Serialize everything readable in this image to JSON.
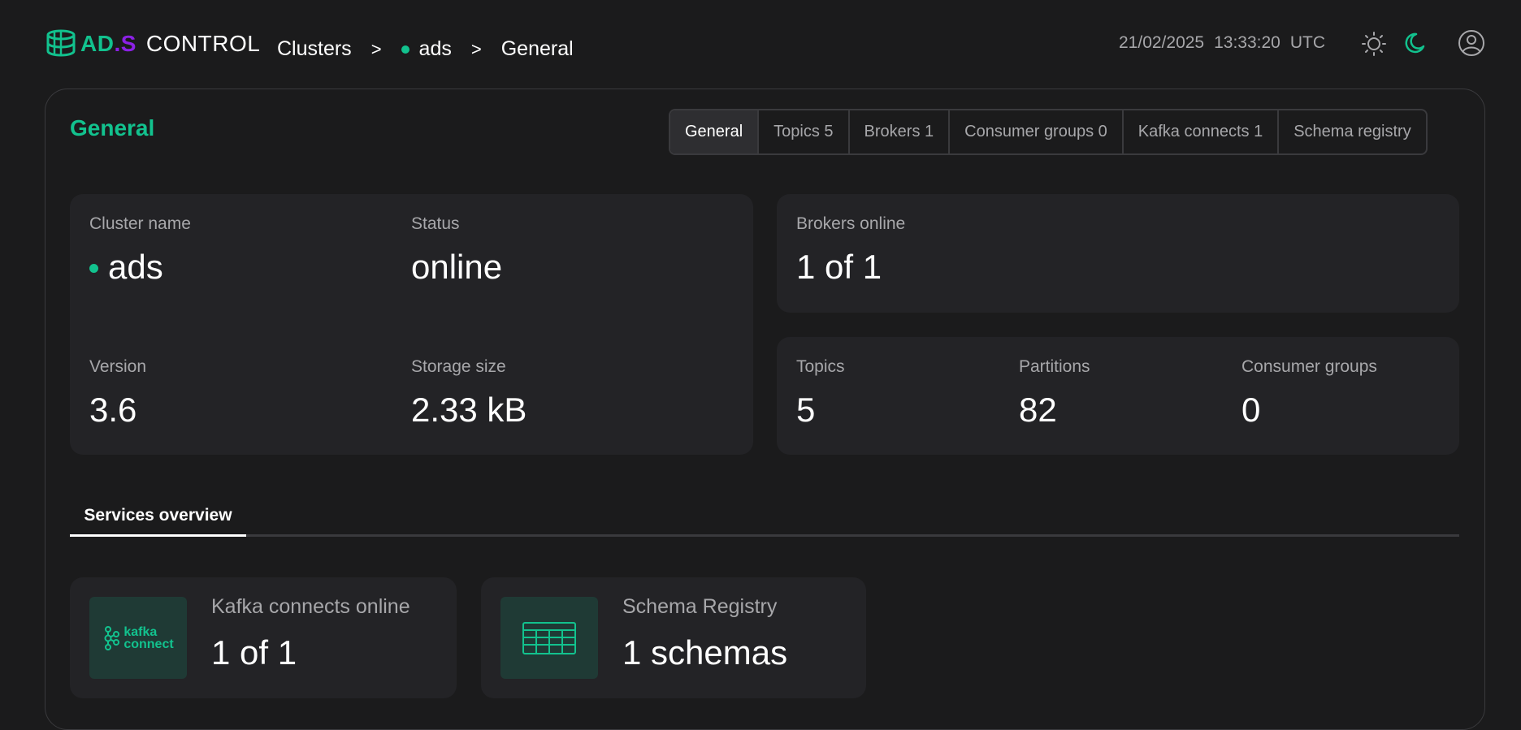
{
  "header": {
    "logo": {
      "ad": "AD",
      "dot": ".",
      "s": "S",
      "control": "CONTROL"
    },
    "breadcrumb": {
      "clusters": "Clusters",
      "sep": ">",
      "cluster": "ads",
      "page": "General"
    },
    "date": "21/02/2025",
    "time": "13:33:20",
    "tz": "UTC"
  },
  "page": {
    "title": "General",
    "tabs": [
      {
        "label": "General",
        "active": true
      },
      {
        "label": "Topics 5"
      },
      {
        "label": "Brokers 1"
      },
      {
        "label": "Consumer groups 0"
      },
      {
        "label": "Kafka connects 1"
      },
      {
        "label": "Schema registry"
      }
    ]
  },
  "cluster_card": {
    "cluster_name_label": "Cluster name",
    "cluster_name": "ads",
    "status_label": "Status",
    "status": "online",
    "version_label": "Version",
    "version": "3.6",
    "storage_label": "Storage size",
    "storage": "2.33 kB"
  },
  "brokers_card": {
    "label": "Brokers online",
    "value": "1 of 1"
  },
  "stats_card": {
    "topics_label": "Topics",
    "topics": "5",
    "partitions_label": "Partitions",
    "partitions": "82",
    "groups_label": "Consumer groups",
    "groups": "0"
  },
  "services": {
    "tab_label": "Services overview",
    "kafka": {
      "logo_line1": "kafka",
      "logo_line2": "connect",
      "label": "Kafka connects online",
      "value": "1 of 1"
    },
    "schema": {
      "label": "Schema Registry",
      "value": "1 schemas"
    }
  },
  "colors": {
    "accent": "#12c28e",
    "brand_purple": "#8c21e6",
    "background": "#1b1b1c",
    "card": "#232326"
  }
}
